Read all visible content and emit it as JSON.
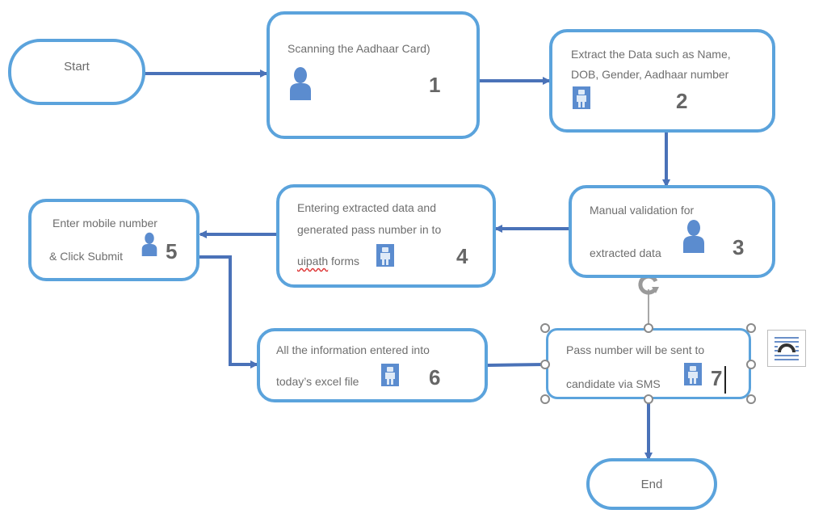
{
  "diagram": {
    "type": "flowchart",
    "colors": {
      "node_border": "#5ba3dc",
      "connector": "#4a72b8",
      "icon": "#5b8ccf",
      "text": "#6e6e6e"
    },
    "start": {
      "label": "Start"
    },
    "end": {
      "label": "End"
    },
    "steps": [
      {
        "id": 1,
        "number": "1",
        "lines": [
          "Scanning the Aadhaar Card)"
        ],
        "actor": "person-icon"
      },
      {
        "id": 2,
        "number": "2",
        "lines": [
          "Extract the Data such as Name,",
          "DOB, Gender, Aadhaar number"
        ],
        "actor": "robot-icon"
      },
      {
        "id": 3,
        "number": "3",
        "lines": [
          "Manual validation for",
          "extracted data"
        ],
        "actor": "person-icon"
      },
      {
        "id": 4,
        "number": "4",
        "lines": [
          "Entering extracted data and",
          "generated pass number in to",
          "uipath",
          " forms"
        ],
        "actor": "robot-icon"
      },
      {
        "id": 5,
        "number": "5",
        "lines": [
          "Enter mobile number",
          "& Click Submit"
        ],
        "actor": "person-icon"
      },
      {
        "id": 6,
        "number": "6",
        "lines": [
          "All the information entered into",
          "today’s excel file"
        ],
        "actor": "robot-icon"
      },
      {
        "id": 7,
        "number": "7",
        "lines": [
          "Pass number will be sent to",
          "candidate via SMS"
        ],
        "actor": "robot-icon",
        "selected": true
      }
    ],
    "edges": [
      [
        "start",
        "1"
      ],
      [
        "1",
        "2"
      ],
      [
        "2",
        "3"
      ],
      [
        "3",
        "4"
      ],
      [
        "4",
        "5"
      ],
      [
        "5",
        "6"
      ],
      [
        "6",
        "7"
      ],
      [
        "7",
        "end"
      ]
    ]
  },
  "editor": {
    "rotate_handle": "rotate-icon",
    "layout_options_button": "text-wrap-layout-icon"
  }
}
